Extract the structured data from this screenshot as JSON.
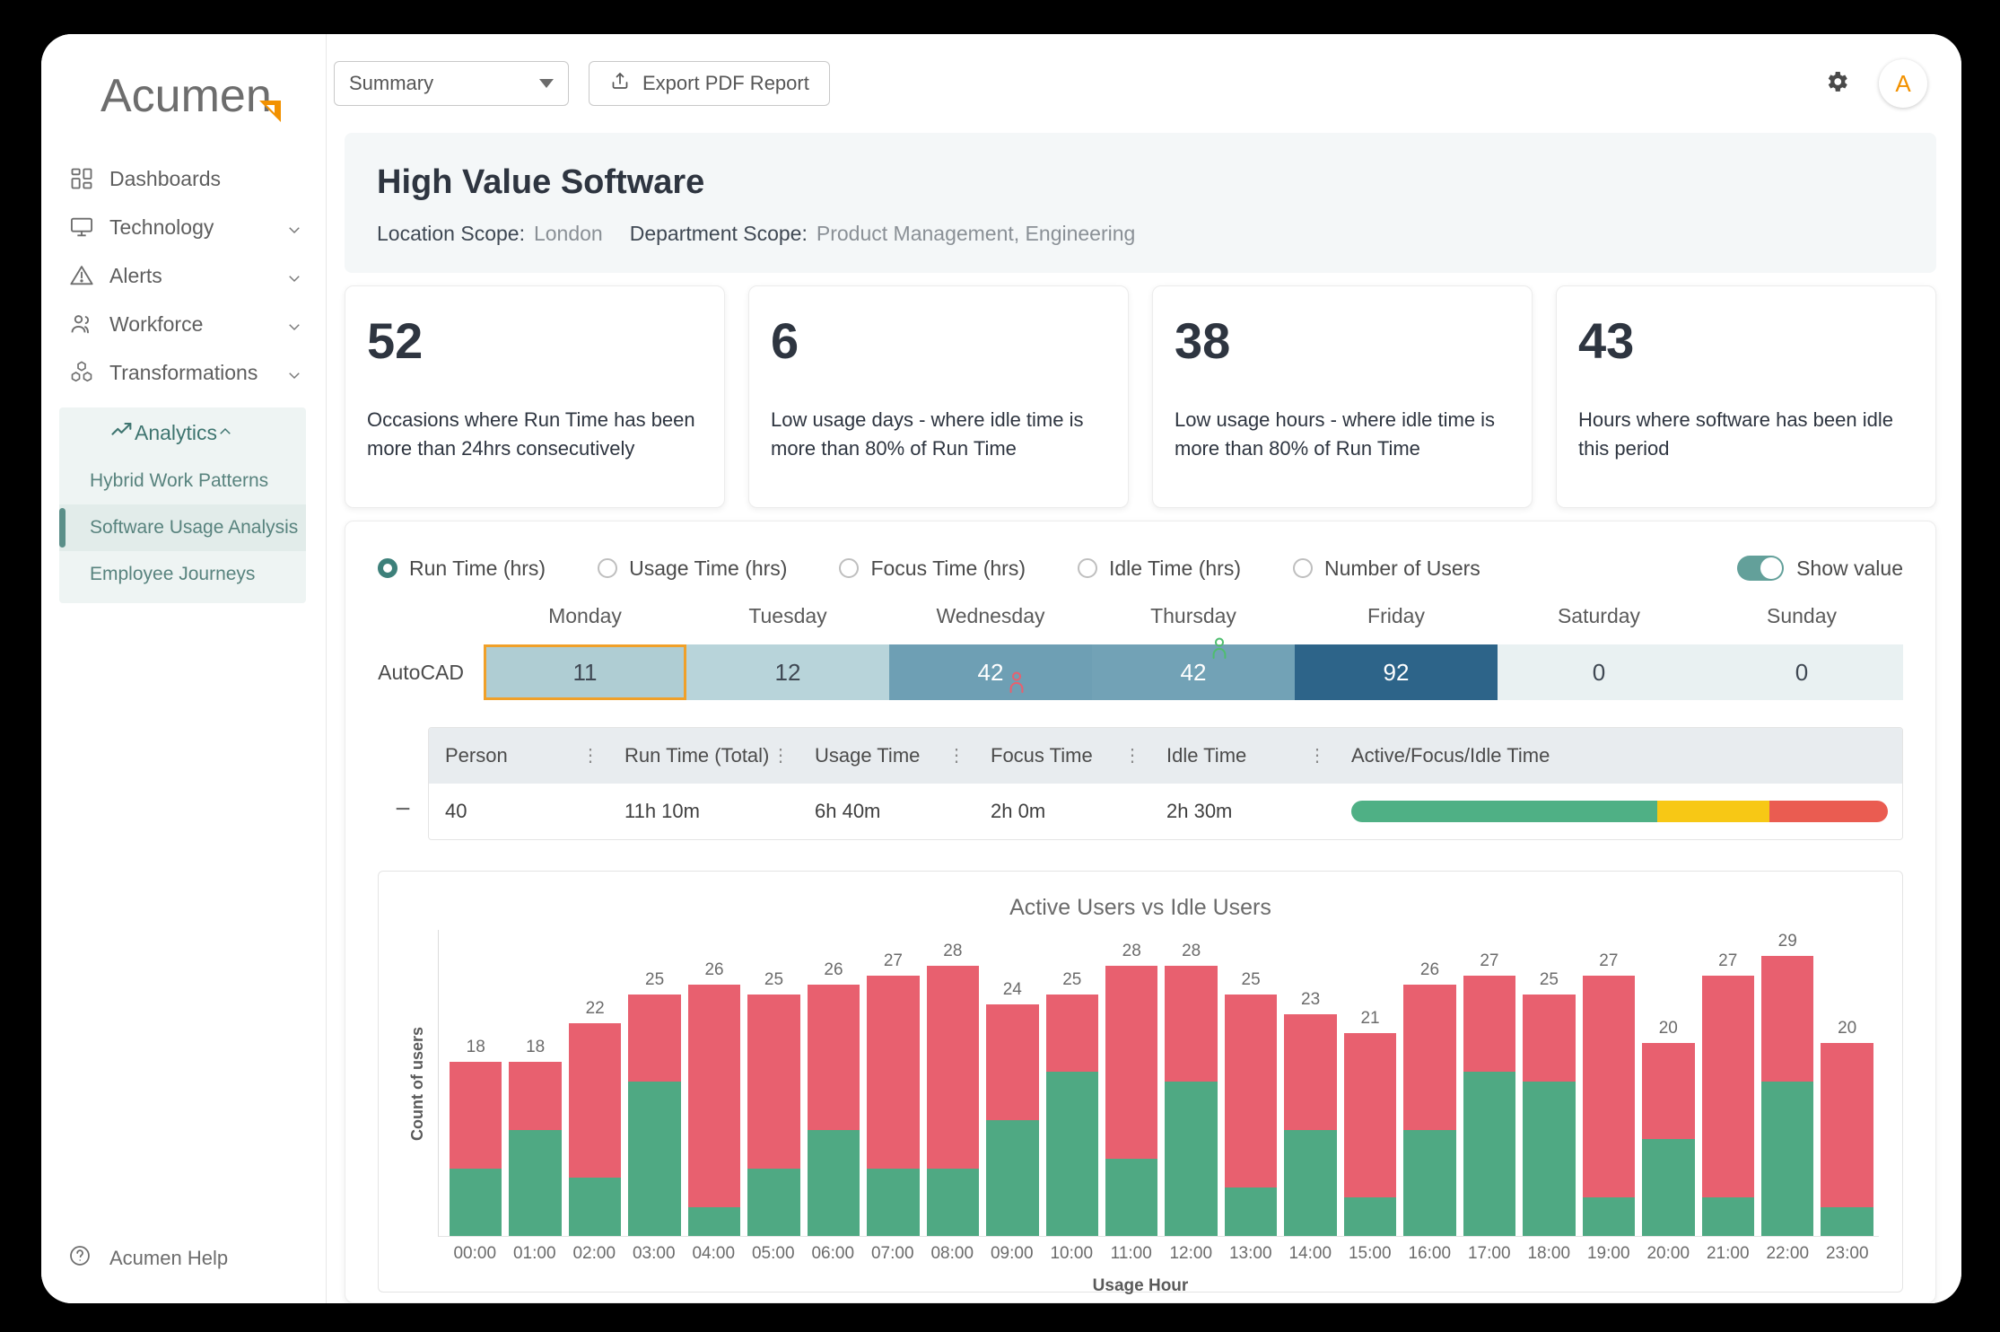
{
  "brand": {
    "name": "Acumen"
  },
  "sidebar": {
    "items": [
      {
        "label": "Dashboards",
        "icon": "grid-icon",
        "chevron": false
      },
      {
        "label": "Technology",
        "icon": "monitor-icon",
        "chevron": true
      },
      {
        "label": "Alerts",
        "icon": "warning-icon",
        "chevron": true
      },
      {
        "label": "Workforce",
        "icon": "people-icon",
        "chevron": true
      },
      {
        "label": "Transformations",
        "icon": "cubes-icon",
        "chevron": true
      }
    ],
    "analytics": {
      "label": "Analytics",
      "icon": "trending-up-icon",
      "sub_items": [
        {
          "label": "Hybrid Work Patterns",
          "active": false
        },
        {
          "label": "Software Usage Analysis",
          "active": true
        },
        {
          "label": "Employee Journeys",
          "active": false
        }
      ]
    },
    "help": {
      "label": "Acumen Help",
      "icon": "question-circle-icon"
    }
  },
  "topbar": {
    "view_select": {
      "value": "Summary"
    },
    "export_button": {
      "label": "Export PDF Report",
      "icon": "upload-icon"
    },
    "settings_icon": "gear-icon",
    "avatar": {
      "initial": "A"
    }
  },
  "header": {
    "title": "High Value Software",
    "location_scope_label": "Location Scope:",
    "location_scope_value": "London",
    "department_scope_label": "Department Scope:",
    "department_scope_value": "Product Management, Engineering"
  },
  "kpis": [
    {
      "value": "52",
      "label": "Occasions where Run Time has been more than 24hrs consecutively"
    },
    {
      "value": "6",
      "label": "Low usage days - where idle time is more than 80% of Run Time"
    },
    {
      "value": "38",
      "label": "Low usage hours - where idle time is more than 80% of Run Time"
    },
    {
      "value": "43",
      "label": "Hours where software has been idle this period"
    }
  ],
  "metric_options": [
    {
      "label": "Run Time (hrs)",
      "selected": true
    },
    {
      "label": "Usage Time (hrs)",
      "selected": false
    },
    {
      "label": "Focus Time (hrs)",
      "selected": false
    },
    {
      "label": "Idle Time (hrs)",
      "selected": false
    },
    {
      "label": "Number of Users",
      "selected": false
    }
  ],
  "show_value_toggle": {
    "label": "Show value",
    "on": true
  },
  "heatmap": {
    "days": [
      "Monday",
      "Tuesday",
      "Wednesday",
      "Thursday",
      "Friday",
      "Saturday",
      "Sunday"
    ],
    "row_label": "AutoCAD",
    "cells": [
      {
        "value": "11",
        "bg": "#afcdd3",
        "fg": "#3f4853",
        "selected": true,
        "marker": null
      },
      {
        "value": "12",
        "bg": "#b8d4da",
        "fg": "#3f4853",
        "selected": false,
        "marker": null
      },
      {
        "value": "42",
        "bg": "#6e9fb4",
        "fg": "#ffffff",
        "selected": false,
        "marker": "red-person-icon"
      },
      {
        "value": "42",
        "bg": "#72a2b6",
        "fg": "#ffffff",
        "selected": false,
        "marker": "green-person-icon"
      },
      {
        "value": "92",
        "bg": "#2d6489",
        "fg": "#ffffff",
        "selected": false,
        "marker": null
      },
      {
        "value": "0",
        "bg": "#e9f1f2",
        "fg": "#3f4853",
        "selected": false,
        "marker": null
      },
      {
        "value": "0",
        "bg": "#e9f1f2",
        "fg": "#3f4853",
        "selected": false,
        "marker": null
      }
    ],
    "marker_colors": {
      "red": "#e8606f",
      "green": "#4fbd6f"
    }
  },
  "table": {
    "expander_icon": "minus-icon",
    "columns": [
      {
        "label": "Person",
        "menu": true
      },
      {
        "label": "Run Time (Total)",
        "menu": true
      },
      {
        "label": "Usage Time",
        "menu": true
      },
      {
        "label": "Focus Time",
        "menu": true
      },
      {
        "label": "Idle Time",
        "menu": true
      },
      {
        "label": "Active/Focus/Idle Time",
        "menu": false
      }
    ],
    "row": {
      "person": "40",
      "run_time": "11h 10m",
      "usage_time": "6h 40m",
      "focus_time": "2h 0m",
      "idle_time": "2h 30m",
      "bar": [
        {
          "name": "active",
          "color": "#4fb085",
          "pct": 57
        },
        {
          "name": "focus",
          "color": "#f7c815",
          "pct": 21
        },
        {
          "name": "idle",
          "color": "#ea5c51",
          "pct": 22
        }
      ]
    }
  },
  "chart_data": {
    "type": "bar",
    "title": "Active Users vs Idle Users",
    "xlabel": "Usage Hour",
    "ylabel": "Count of users",
    "stacked": true,
    "ylim": [
      0,
      30
    ],
    "grid": false,
    "categories": [
      "00:00",
      "01:00",
      "02:00",
      "03:00",
      "04:00",
      "05:00",
      "06:00",
      "07:00",
      "08:00",
      "09:00",
      "10:00",
      "11:00",
      "12:00",
      "13:00",
      "14:00",
      "15:00",
      "16:00",
      "17:00",
      "18:00",
      "19:00",
      "20:00",
      "21:00",
      "22:00",
      "23:00"
    ],
    "totals": [
      18,
      18,
      22,
      25,
      26,
      25,
      26,
      27,
      28,
      24,
      25,
      28,
      28,
      25,
      23,
      21,
      26,
      27,
      25,
      27,
      20,
      27,
      29,
      20
    ],
    "series": [
      {
        "name": "Active Users",
        "color": "#4fa983",
        "values": [
          7,
          11,
          6,
          16,
          3,
          7,
          11,
          7,
          7,
          12,
          17,
          8,
          16,
          5,
          11,
          4,
          11,
          17,
          16,
          4,
          10,
          4,
          16,
          3
        ]
      },
      {
        "name": "Idle Users",
        "color": "#e8606f",
        "values": [
          11,
          7,
          16,
          9,
          23,
          18,
          15,
          20,
          21,
          12,
          8,
          20,
          12,
          20,
          12,
          17,
          15,
          10,
          9,
          23,
          10,
          23,
          13,
          17
        ]
      }
    ]
  }
}
